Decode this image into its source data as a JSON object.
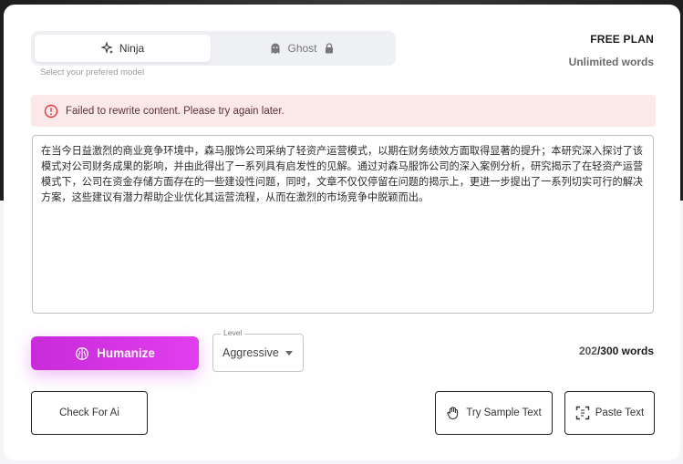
{
  "model_selector": {
    "tabs": [
      {
        "label": "Ninja",
        "icon": "sparkle-ninja-icon",
        "active": true
      },
      {
        "label": "Ghost",
        "icon": "ghost-icon",
        "locked": true
      }
    ],
    "hint": "Select your prefered model"
  },
  "plan": {
    "name": "FREE PLAN",
    "words": "Unlimited words"
  },
  "error": {
    "message": "Failed to rewrite content. Please try again later.",
    "icon": "alert-circle-icon",
    "color": "#e0393e"
  },
  "editor": {
    "text": "在当今日益激烈的商业竞争环境中，森马服饰公司采纳了轻资产运营模式，以期在财务绩效方面取得显著的提升；本研究深入探讨了该模式对公司财务成果的影响，并由此得出了一系列具有启发性的见解。通过对森马服饰公司的深入案例分析，研究揭示了在轻资产运营模式下，公司在资金存储方面存在的一些建设性问题，同时，文章不仅仅停留在问题的揭示上，更进一步提出了一系列切实可行的解决方案，这些建议有潜力帮助企业优化其运营流程，从而在激烈的市场竞争中脱颖而出。"
  },
  "actions": {
    "humanize_label": "Humanize",
    "level_legend": "Level",
    "level_value": "Aggressive",
    "word_count_current": "202",
    "word_count_limit": "/300 words",
    "check_ai_label": "Check For Ai",
    "sample_label": "Try Sample Text",
    "paste_label": "Paste Text"
  },
  "colors": {
    "accent_start": "#c82bd9",
    "accent_end": "#e13ef0",
    "error_bg": "#fbe9ea"
  }
}
